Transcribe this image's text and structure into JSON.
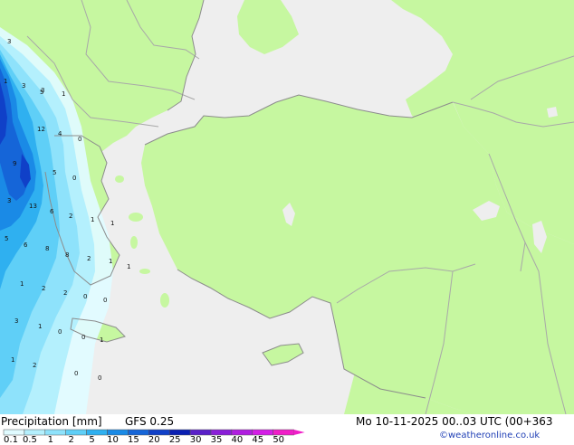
{
  "footer": {
    "title": "Precipitation [mm]",
    "model": "GFS 0.25",
    "valid_time": "Mo 10-11-2025 00..03 UTC (00+363",
    "credit": "©weatheronline.co.uk"
  },
  "legend": {
    "labels": [
      "0.1",
      "0.5",
      "1",
      "2",
      "5",
      "10",
      "15",
      "20",
      "25",
      "30",
      "35",
      "40",
      "45",
      "50"
    ],
    "colors": [
      "#e0fbff",
      "#b4f0fd",
      "#8ee2fb",
      "#5fcff7",
      "#2fb0f0",
      "#1a8ae6",
      "#1565d8",
      "#1040c8",
      "#0a1fb2",
      "#5a20c8",
      "#8a1ed8",
      "#b01ee0",
      "#d41ee6",
      "#f01ec8"
    ]
  },
  "map": {
    "colors": {
      "land": "#c6f7a0",
      "sea": "#eeeeee",
      "border": "#a8a8a8",
      "coast": "#8c8c8c"
    },
    "precip_labels": [
      {
        "text": "3",
        "v": 3
      },
      {
        "text": "3",
        "v": 3
      },
      {
        "text": "3",
        "v": 3
      },
      {
        "text": "1",
        "v": 1
      },
      {
        "text": "1",
        "v": 1
      },
      {
        "text": "5",
        "v": 5
      },
      {
        "text": "12",
        "v": 12
      },
      {
        "text": "4",
        "v": 4
      },
      {
        "text": "0",
        "v": 0
      },
      {
        "text": "9",
        "v": 9
      },
      {
        "text": "5",
        "v": 5
      },
      {
        "text": "0",
        "v": 0
      },
      {
        "text": "3",
        "v": 3
      },
      {
        "text": "13",
        "v": 13
      },
      {
        "text": "6",
        "v": 6
      },
      {
        "text": "2",
        "v": 2
      },
      {
        "text": "1",
        "v": 1
      },
      {
        "text": "1",
        "v": 1
      },
      {
        "text": "5",
        "v": 5
      },
      {
        "text": "6",
        "v": 6
      },
      {
        "text": "8",
        "v": 8
      },
      {
        "text": "8",
        "v": 8
      },
      {
        "text": "2",
        "v": 2
      },
      {
        "text": "1",
        "v": 1
      },
      {
        "text": "1",
        "v": 1
      },
      {
        "text": "1",
        "v": 1
      },
      {
        "text": "2",
        "v": 2
      },
      {
        "text": "2",
        "v": 2
      },
      {
        "text": "0",
        "v": 0
      },
      {
        "text": "0",
        "v": 0
      },
      {
        "text": "3",
        "v": 3
      },
      {
        "text": "1",
        "v": 1
      },
      {
        "text": "0",
        "v": 0
      },
      {
        "text": "0",
        "v": 0
      },
      {
        "text": "1",
        "v": 1
      },
      {
        "text": "1",
        "v": 1
      },
      {
        "text": "2",
        "v": 2
      },
      {
        "text": "0",
        "v": 0
      },
      {
        "text": "0",
        "v": 0
      }
    ]
  }
}
